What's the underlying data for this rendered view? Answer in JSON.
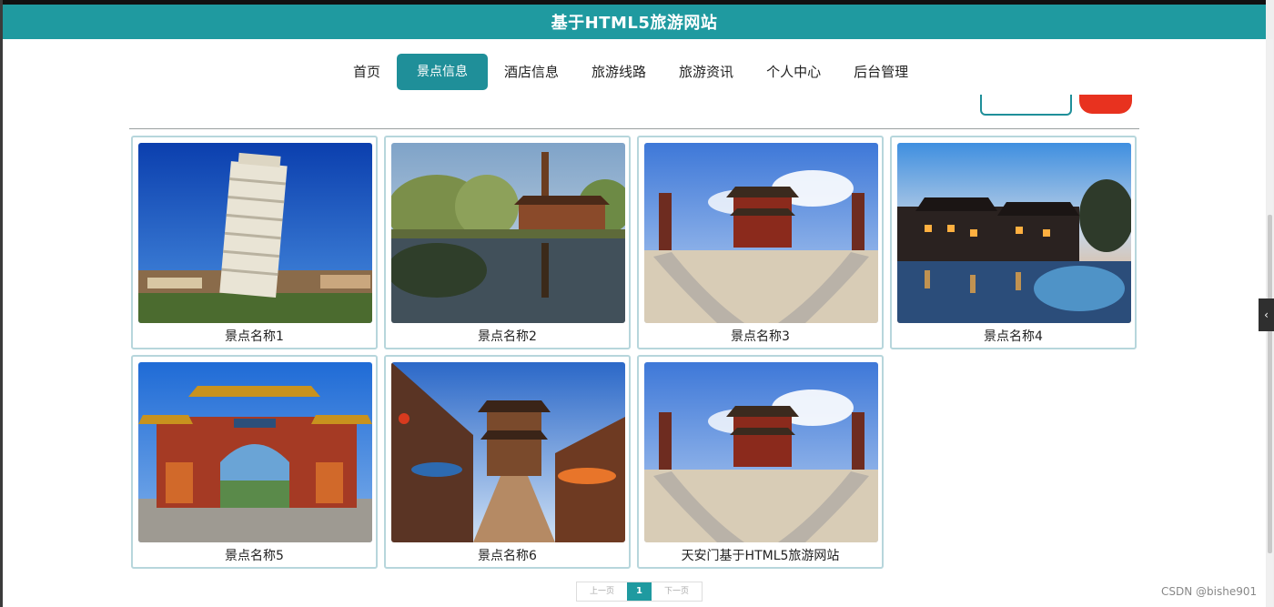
{
  "header": {
    "title": "基于HTML5旅游网站"
  },
  "nav": {
    "items": [
      {
        "label": "首页",
        "active": false
      },
      {
        "label": "景点信息",
        "active": true
      },
      {
        "label": "酒店信息",
        "active": false
      },
      {
        "label": "旅游线路",
        "active": false
      },
      {
        "label": "旅游资讯",
        "active": false
      },
      {
        "label": "个人中心",
        "active": false
      },
      {
        "label": "后台管理",
        "active": false
      }
    ]
  },
  "colors": {
    "brand": "#1f9aa0",
    "nav_active": "#1f8f99",
    "action_red": "#e8321f"
  },
  "attractions": [
    {
      "name": "景点名称1",
      "image": "leaning-tower-photo"
    },
    {
      "name": "景点名称2",
      "image": "pagoda-lake-photo"
    },
    {
      "name": "景点名称3",
      "image": "palace-towers-photo"
    },
    {
      "name": "景点名称4",
      "image": "water-town-night-photo"
    },
    {
      "name": "景点名称5",
      "image": "red-gate-photo"
    },
    {
      "name": "景点名称6",
      "image": "ancient-street-photo"
    },
    {
      "name": "天安门基于HTML5旅游网站",
      "image": "palace-towers-photo"
    }
  ],
  "pagination": {
    "prev": "上一页",
    "current": "1",
    "next": "下一页"
  },
  "watermark": "CSDN @bishe901"
}
